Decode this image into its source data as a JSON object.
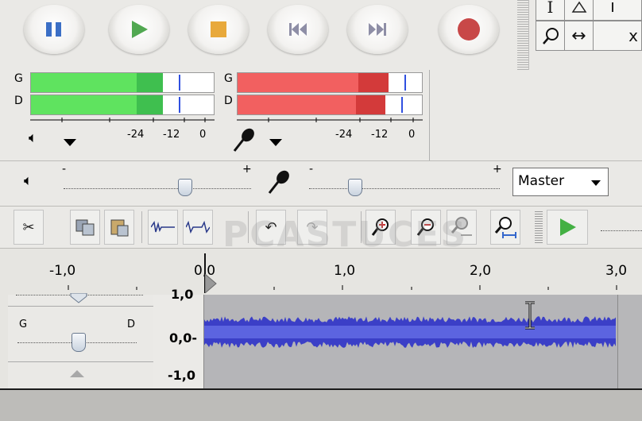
{
  "meters": {
    "playback": {
      "left_label": "G",
      "right_label": "D",
      "ticks": [
        "-24",
        "-12",
        "0"
      ],
      "level_left": 0.72,
      "level_right": 0.72
    },
    "record": {
      "left_label": "G",
      "right_label": "D",
      "ticks": [
        "-24",
        "-12",
        "0"
      ],
      "level_left": 0.82,
      "level_right": 0.8
    }
  },
  "mixer": {
    "output_minus": "-",
    "output_plus": "+",
    "input_minus": "-",
    "input_plus": "+",
    "output_volume": 0.65,
    "input_volume": 0.24,
    "source_selected": "Master"
  },
  "ruler": {
    "ticks": [
      "-1,0",
      "0,0",
      "1,0",
      "2,0",
      "3,0"
    ]
  },
  "track": {
    "pan_left": "G",
    "pan_right": "D",
    "scale_top": "1,0",
    "scale_mid": "0,0-",
    "scale_bottom": "-1,0"
  },
  "watermark": "PCASTUCES",
  "colors": {
    "playback_meter": "#5fe35f",
    "record_meter": "#f26060",
    "waveform": "#3b3fc7",
    "peak_marker": "#3050e0"
  }
}
